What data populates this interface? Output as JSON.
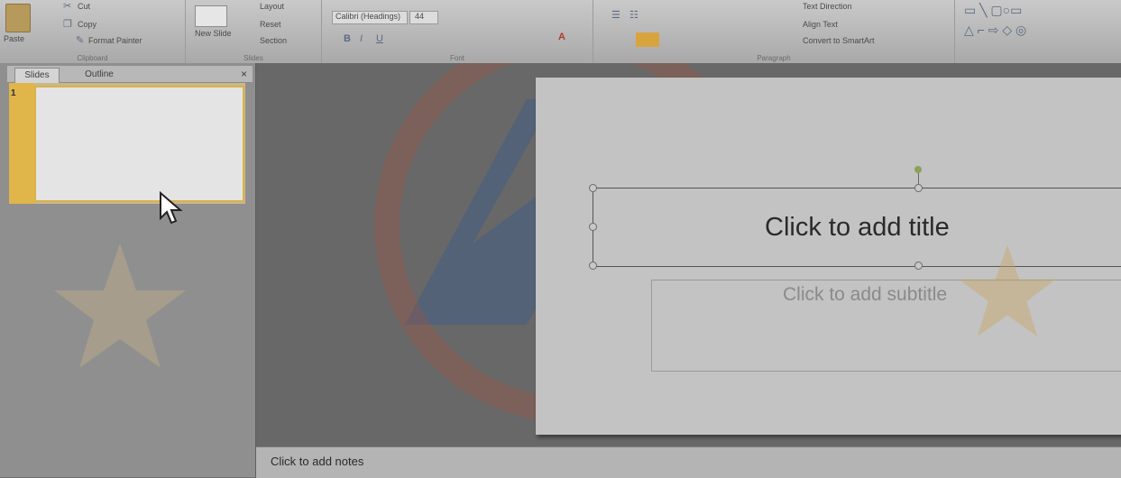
{
  "ribbon": {
    "clipboard": {
      "paste": "Paste",
      "cut": "Cut",
      "copy": "Copy",
      "format_painter": "Format Painter",
      "label": "Clipboard"
    },
    "slides": {
      "new_slide": "New Slide",
      "layout": "Layout",
      "reset": "Reset",
      "section": "Section",
      "label": "Slides"
    },
    "font": {
      "family": "Calibri (Headings)",
      "size": "44",
      "label": "Font"
    },
    "paragraph": {
      "text_direction": "Text Direction",
      "align_text": "Align Text",
      "convert_smartart": "Convert to SmartArt",
      "label": "Paragraph"
    }
  },
  "panel": {
    "tab_slides": "Slides",
    "tab_outline": "Outline",
    "close": "×",
    "slide_number": "1"
  },
  "slide": {
    "title_placeholder": "Click to add title",
    "subtitle_placeholder": "Click to add subtitle"
  },
  "notes": {
    "placeholder": "Click to add notes"
  },
  "colors": {
    "selection": "#e0b54a",
    "watermark_red": "#c0533a",
    "watermark_blue": "#3a5a8a"
  }
}
